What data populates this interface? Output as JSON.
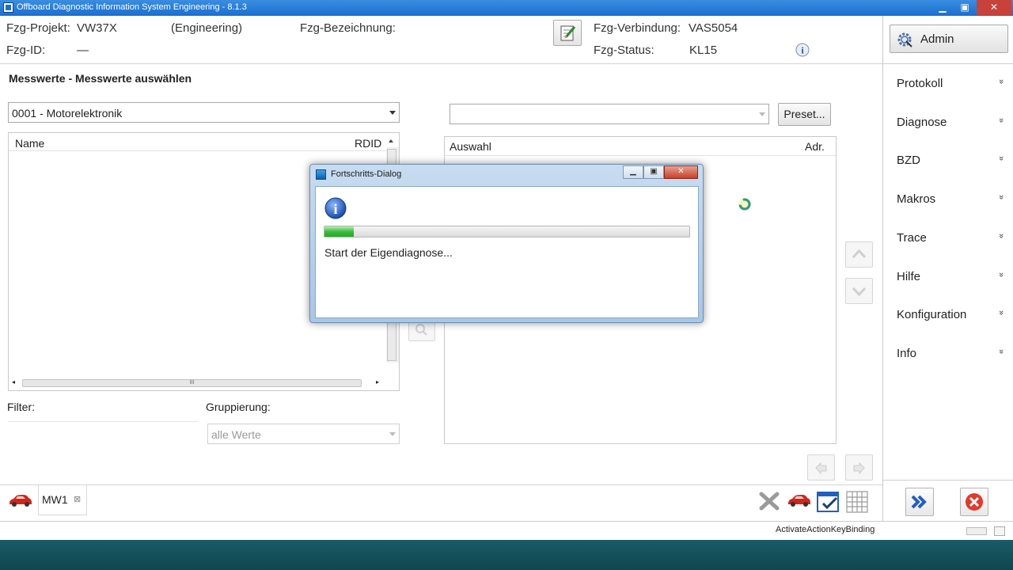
{
  "window": {
    "title": "Offboard Diagnostic Information System Engineering - 8.1.3",
    "min": "▁",
    "max": "▣",
    "close": "✕"
  },
  "header": {
    "projekt_label": "Fzg-Projekt:",
    "projekt_value": "VW37X",
    "mode": "(Engineering)",
    "bezeichnung_label": "Fzg-Bezeichnung:",
    "id_label": "Fzg-ID:",
    "id_value": "—",
    "verbindung_label": "Fzg-Verbindung:",
    "verbindung_value": "VAS5054",
    "status_label": "Fzg-Status:",
    "status_value": "KL15"
  },
  "sidebar": {
    "admin_label": "Admin",
    "items": [
      {
        "label": "Protokoll"
      },
      {
        "label": "Diagnose"
      },
      {
        "label": "BZD"
      },
      {
        "label": "Makros"
      },
      {
        "label": "Trace"
      },
      {
        "label": "Hilfe"
      },
      {
        "label": "Konfiguration"
      },
      {
        "label": "Info"
      }
    ],
    "chevron": "»"
  },
  "main": {
    "heading": "Messwerte - Messwerte auswählen",
    "ecu_select": "0001 - Motorelektronik",
    "list_col_name": "Name",
    "list_col_rdid": "RDID",
    "preset_label": "Preset...",
    "selection_col_auswahl": "Auswahl",
    "selection_col_adr": "Adr.",
    "filter_label": "Filter:",
    "gruppierung_label": "Gruppierung:",
    "gruppierung_value": "alle Werte",
    "scroll_grip": "III"
  },
  "tabs": [
    {
      "label": "MW1",
      "close": "⊠"
    }
  ],
  "statusbar": {
    "text": "ActivateActionKeyBinding"
  },
  "dialog": {
    "title": "Fortschritts-Dialog",
    "message": "Start der Eigendiagnose...",
    "progress": 0.08
  }
}
